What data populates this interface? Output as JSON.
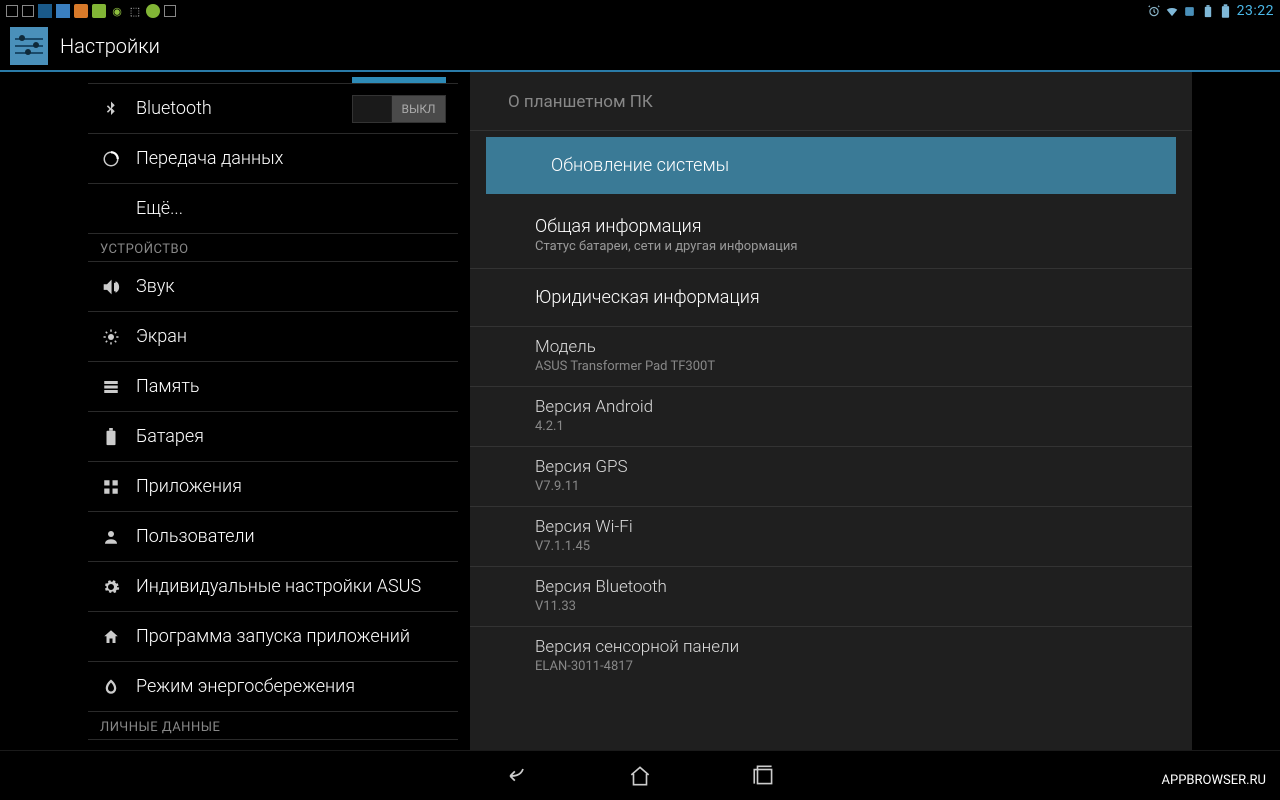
{
  "status": {
    "time": "23:22"
  },
  "app": {
    "title": "Настройки"
  },
  "sidebar": {
    "bluetooth": {
      "label": "Bluetooth",
      "toggle": "ВЫКЛ"
    },
    "data": {
      "label": "Передача данных"
    },
    "more": {
      "label": "Ещё..."
    },
    "section_device": "УСТРОЙСТВО",
    "sound": {
      "label": "Звук"
    },
    "display": {
      "label": "Экран"
    },
    "storage": {
      "label": "Память"
    },
    "battery": {
      "label": "Батарея"
    },
    "apps": {
      "label": "Приложения"
    },
    "users": {
      "label": "Пользователи"
    },
    "asus": {
      "label": "Индивидуальные настройки ASUS"
    },
    "launcher": {
      "label": "Программа запуска приложений"
    },
    "power": {
      "label": "Режим энергосбережения"
    },
    "section_personal": "ЛИЧНЫЕ ДАННЫЕ"
  },
  "main": {
    "header": "О планшетном ПК",
    "system_update": "Обновление системы",
    "general_info": {
      "title": "Общая информация",
      "sub": "Статус батареи, сети и другая информация"
    },
    "legal": {
      "title": "Юридическая информация"
    },
    "model": {
      "title": "Модель",
      "value": "ASUS Transformer Pad TF300T"
    },
    "android": {
      "title": "Версия Android",
      "value": "4.2.1"
    },
    "gps": {
      "title": "Версия GPS",
      "value": "V7.9.11"
    },
    "wifi": {
      "title": "Версия Wi-Fi",
      "value": "V7.1.1.45"
    },
    "bluetooth": {
      "title": "Версия Bluetooth",
      "value": "V11.33"
    },
    "touch": {
      "title": "Версия сенсорной панели",
      "value": "ELAN-3011-4817"
    }
  },
  "watermark": "APPBROWSER.RU"
}
